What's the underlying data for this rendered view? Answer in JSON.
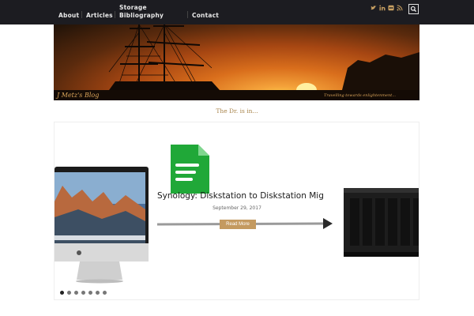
{
  "nav": {
    "items": [
      {
        "label": "About"
      },
      {
        "label": "Articles"
      },
      {
        "label": "Storage Bibliography"
      },
      {
        "label": "Contact"
      }
    ],
    "social_icons": [
      "twitter-icon",
      "linkedin-icon",
      "flickr-icon",
      "rss-icon"
    ],
    "search_icon": "search-icon"
  },
  "header": {
    "brand": "J Metz's Blog",
    "tagline": "Travelling towards enlightenment...",
    "subtitle": "The Dr. is in..."
  },
  "slider": {
    "post_title": "Synology: Diskstation to Diskstation Migra..",
    "post_date": "September 29, 2017",
    "read_more": "Read More",
    "slide_count": 7,
    "active_slide": 1
  },
  "colors": {
    "topbar": "#1c1c21",
    "accent": "#c49a60",
    "subtitle": "#a8844b"
  }
}
